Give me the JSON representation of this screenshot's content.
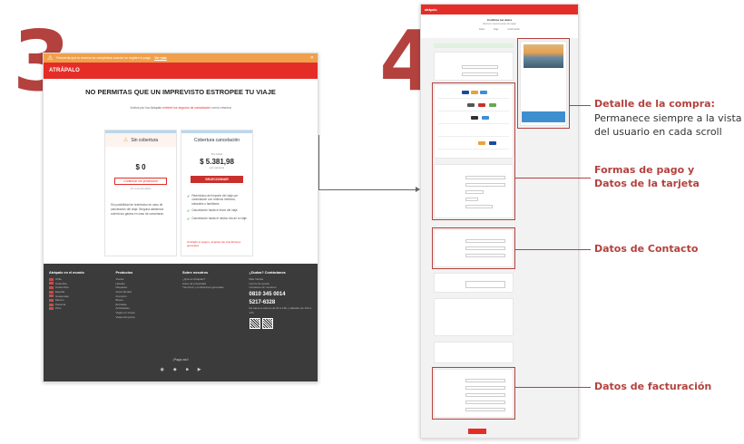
{
  "step_left": "3",
  "step_right": "4",
  "left": {
    "warning_text": "Recuerda que tu reserva se completará cuando se registre tu pago",
    "warning_link": "Ver más",
    "brand": "ATRÁPALO",
    "hero_title": "NO PERMITAS QUE UN IMPREVISTO ESTROPEE TU VIAJE",
    "hero_sub_1": "Vuelos por los Atrápalo ",
    "hero_sub_link": "entrevé los seguros de cancelación",
    "hero_sub_2": " con tu reserva",
    "card1": {
      "title": "Sin cobertura",
      "price": "$ 0",
      "button": "Continuar sin protección",
      "note": "No recomendado",
      "text": "Sin posibilidad de reembolso en caso de cancelación del viaje. Ninguna asistencia cubrirá tus gastos en caso de cancelarse."
    },
    "card2": {
      "title": "Cobertura cancelación",
      "price_label": "Por ticket",
      "price": "$ 5.381,98",
      "price_per": "por persona",
      "button": "SELECCIONAR",
      "checks": [
        "Reembolso del importe del viaje por cancelación con motivos médicos, laborales o familiares",
        "Cancelación hasta el inicio del viaje",
        "Cancelación hasta el mismo día de tu viaje"
      ],
      "terms": "Al añadir el seguro, aceptas las Condiciones generales"
    },
    "footer": {
      "col1_title": "Atrápalo en el mundo",
      "col1_items": [
        "Chile",
        "Colombia",
        "Costa Rica",
        "España",
        "Guatemala",
        "México",
        "Panamá",
        "Perú"
      ],
      "col2_title": "Productos",
      "col2_items": [
        "Vuelos",
        "Hoteles",
        "Paquetes",
        "Autos Rental",
        "Cruceros",
        "Buses",
        "Entradas",
        "Actividades",
        "Viajes en Grupo",
        "Viajes Empresa"
      ],
      "col3_title": "Sobre nosotros",
      "col3_items": [
        "¿Qué es Atrápalo?",
        "Aviso de privacidad",
        "Términos y condiciones generales"
      ],
      "col4_title": "¿Dudas? Contáctanos",
      "col4_items": [
        "Más Ventas",
        "Centro de ayuda",
        "Contacta con nosotros"
      ],
      "phone1": "0810 345 0014",
      "phone2": "5217-6328",
      "hours": "De lunes a viernes de 9h a 19h y sábados de 10h a 14h",
      "pagar": "¡Paga así!",
      "social": [
        "RSS",
        "Twitter",
        "Facebook",
        "YouTube"
      ]
    }
  },
  "right": {
    "brand": "atrápalo",
    "head_title": "Confirma tus datos",
    "head_sub": "Revisa tu reserva antes de pagar",
    "steps": [
      "Datos",
      "Pago",
      "Confirmación"
    ]
  },
  "annotations": {
    "detalle_title": "Detalle de la compra:",
    "detalle_text_1": "Permanece siempre a la vista",
    "detalle_text_2": "del usuario en cada scroll",
    "formas_1": "Formas de pago y",
    "formas_2": "Datos de la tarjeta",
    "contacto": "Datos de Contacto",
    "facturacion": "Datos de facturación"
  },
  "colors": {
    "accent": "#b3413d",
    "brand_red": "#e52d27"
  }
}
